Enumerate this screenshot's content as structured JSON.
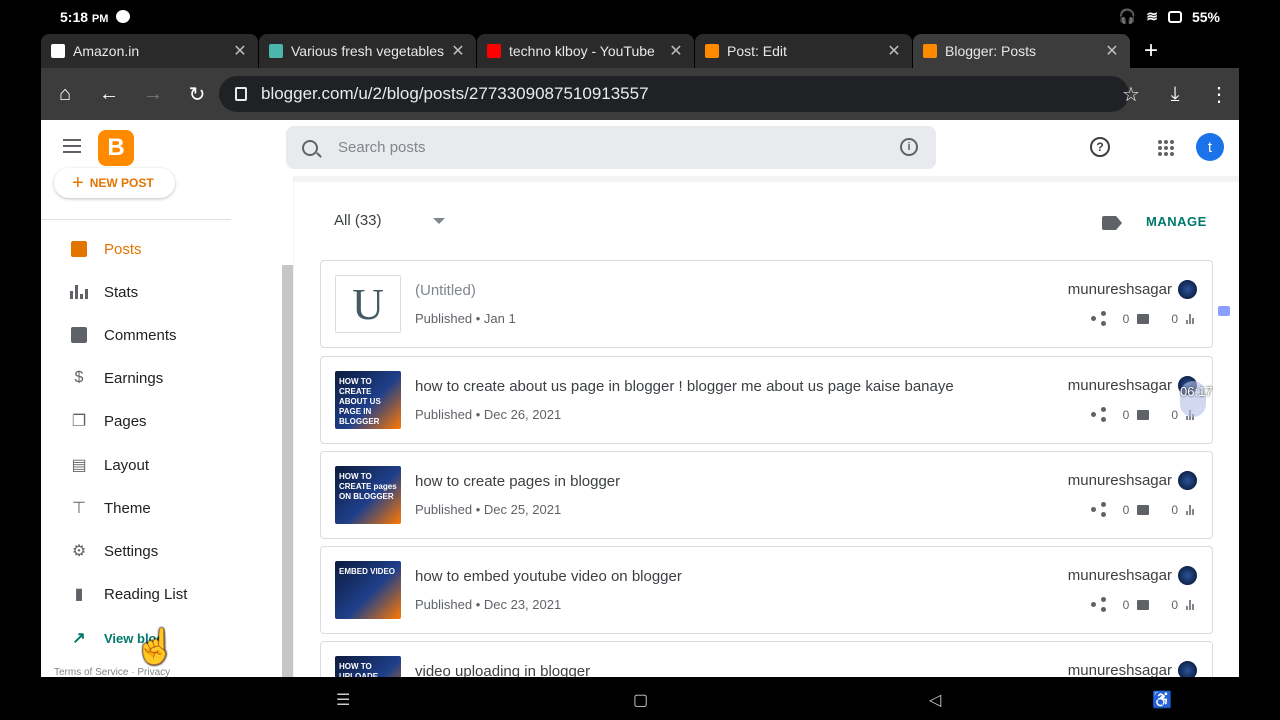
{
  "status_bar": {
    "time": "5:18",
    "ampm": "PM",
    "battery": "55%"
  },
  "tabs": [
    {
      "title": "Amazon.in",
      "color": "#ffffff"
    },
    {
      "title": "Various fresh vegetables",
      "color": "#4db6ac"
    },
    {
      "title": "techno klboy - YouTube",
      "color": "#ff0000"
    },
    {
      "title": "Post: Edit",
      "color": "#ff8a00"
    },
    {
      "title": "Blogger: Posts",
      "color": "#ff8a00"
    }
  ],
  "url": "blogger.com/u/2/blog/posts/2773309087510913557",
  "header": {
    "search_placeholder": "Search posts",
    "avatar_letter": "t",
    "logo_letter": "B"
  },
  "sidebar": {
    "new_post": "NEW POST",
    "items": [
      {
        "label": "Posts",
        "icon": "posts-icon"
      },
      {
        "label": "Stats",
        "icon": "stats-icon"
      },
      {
        "label": "Comments",
        "icon": "comments-icon"
      },
      {
        "label": "Earnings",
        "icon": "dollar-icon"
      },
      {
        "label": "Pages",
        "icon": "pages-icon"
      },
      {
        "label": "Layout",
        "icon": "layout-icon"
      },
      {
        "label": "Theme",
        "icon": "paint-roller-icon"
      },
      {
        "label": "Settings",
        "icon": "gear-icon"
      },
      {
        "label": "Reading List",
        "icon": "bookmark-icon"
      }
    ],
    "view_blog": "View blog",
    "footer": "Terms of Service · Privacy"
  },
  "main": {
    "filter": "All (33)",
    "manage": "MANAGE",
    "posts": [
      {
        "title": "(Untitled)",
        "meta": "Published • Jan 1",
        "author": "munureshsagar",
        "comments": "0",
        "views": "0",
        "thumb_letter": "U",
        "thumb_text": ""
      },
      {
        "title": "how to create about us page in blogger ! blogger me about us page kaise banaye",
        "meta": "Published • Dec 26, 2021",
        "author": "munureshsagar",
        "comments": "0",
        "views": "0",
        "thumb_letter": "",
        "thumb_text": "HOW TO CREATE ABOUT US PAGE IN BLOGGER"
      },
      {
        "title": "how to create pages in blogger",
        "meta": "Published • Dec 25, 2021",
        "author": "munureshsagar",
        "comments": "0",
        "views": "0",
        "thumb_letter": "",
        "thumb_text": "HOW TO CREATE pages ON BLOGGER"
      },
      {
        "title": "how to embed youtube video on blogger",
        "meta": "Published • Dec 23, 2021",
        "author": "munureshsagar",
        "comments": "0",
        "views": "0",
        "thumb_letter": "",
        "thumb_text": "EMBED VIDEO"
      },
      {
        "title": "video uploading in blogger",
        "meta": "",
        "author": "munureshsagar",
        "comments": "",
        "views": "",
        "thumb_letter": "",
        "thumb_text": "HOW TO UPLOADE"
      }
    ]
  },
  "overlay": {
    "video_time": "06:17"
  }
}
